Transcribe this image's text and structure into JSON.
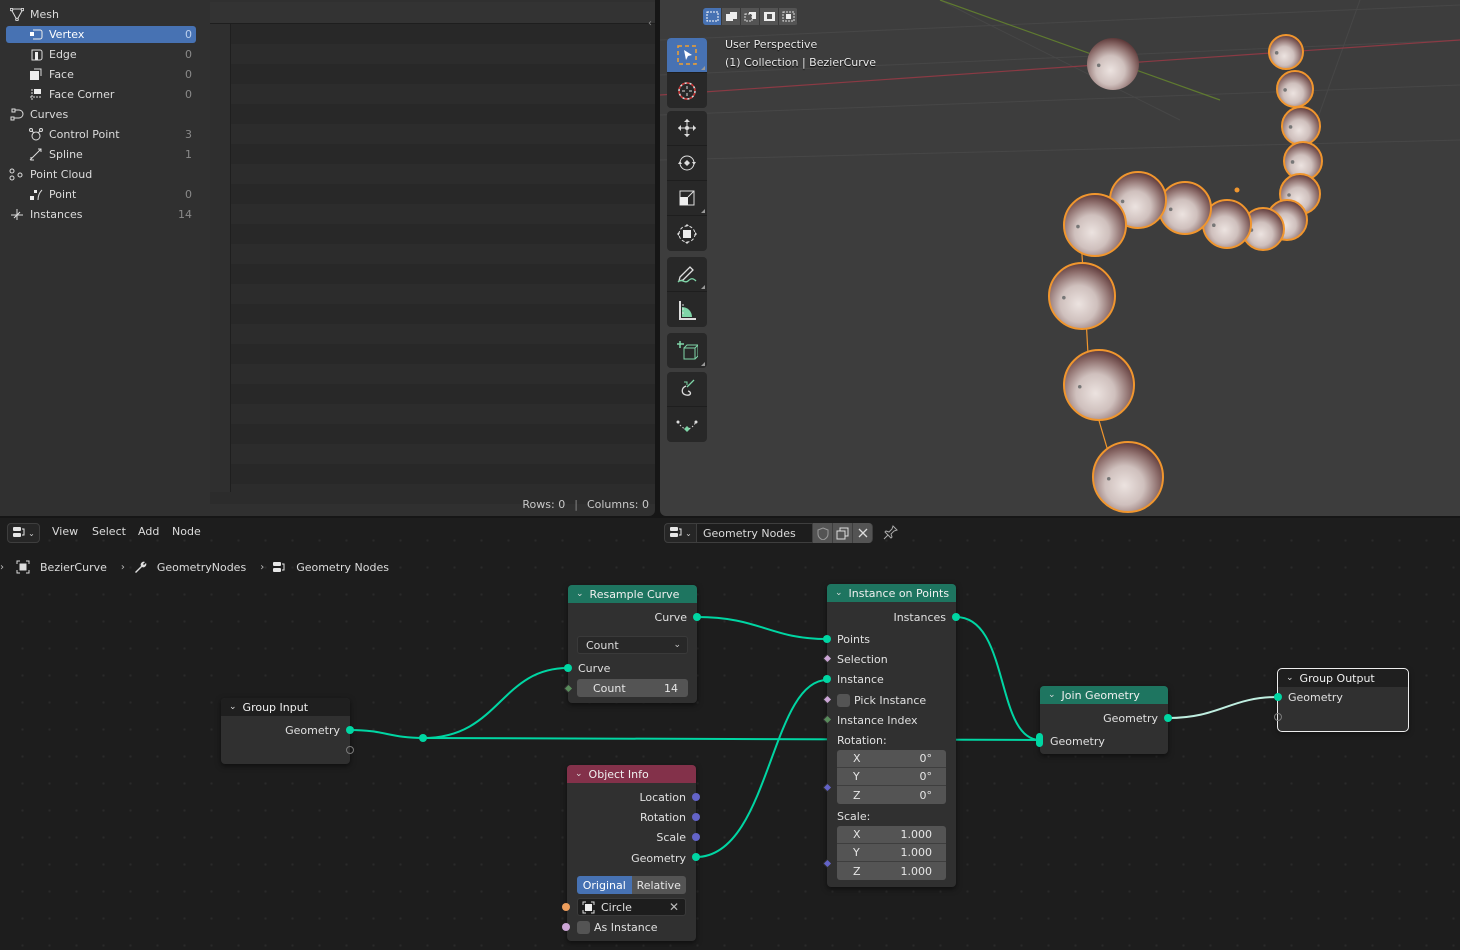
{
  "spreadsheet": {
    "domains": [
      {
        "label": "Mesh",
        "icon": "mesh-icon",
        "level": 0,
        "count": null,
        "selected": false
      },
      {
        "label": "Vertex",
        "icon": "vertex-icon",
        "level": 1,
        "count": "0",
        "selected": true
      },
      {
        "label": "Edge",
        "icon": "edge-icon",
        "level": 1,
        "count": "0",
        "selected": false
      },
      {
        "label": "Face",
        "icon": "face-icon",
        "level": 1,
        "count": "0",
        "selected": false
      },
      {
        "label": "Face Corner",
        "icon": "face-corner-icon",
        "level": 1,
        "count": "0",
        "selected": false
      },
      {
        "label": "Curves",
        "icon": "curves-icon",
        "level": 0,
        "count": null,
        "selected": false
      },
      {
        "label": "Control Point",
        "icon": "control-point-icon",
        "level": 1,
        "count": "3",
        "selected": false
      },
      {
        "label": "Spline",
        "icon": "spline-icon",
        "level": 1,
        "count": "1",
        "selected": false
      },
      {
        "label": "Point Cloud",
        "icon": "point-cloud-icon",
        "level": 0,
        "count": null,
        "selected": false
      },
      {
        "label": "Point",
        "icon": "point-icon",
        "level": 1,
        "count": "0",
        "selected": false
      },
      {
        "label": "Instances",
        "icon": "instances-icon",
        "level": 0,
        "count": "14",
        "selected": false
      }
    ],
    "footer": {
      "rows": "Rows: 0",
      "separator": "|",
      "columns": "Columns: 0"
    }
  },
  "viewport": {
    "perspective": "User Perspective",
    "collection": "(1) Collection | BezierCurve",
    "select_modes": [
      "select-new-icon",
      "select-extend-icon",
      "select-subtract-icon",
      "select-invert-icon",
      "select-intersect-icon"
    ],
    "tools": [
      {
        "group": 0,
        "name": "select-box-tool",
        "active": true
      },
      {
        "group": 0,
        "name": "cursor-tool",
        "active": false
      },
      {
        "group": 1,
        "name": "move-tool",
        "active": false
      },
      {
        "group": 1,
        "name": "rotate-tool",
        "active": false
      },
      {
        "group": 1,
        "name": "scale-tool",
        "active": false
      },
      {
        "group": 1,
        "name": "transform-tool",
        "active": false
      },
      {
        "group": 2,
        "name": "annotate-tool",
        "active": false
      },
      {
        "group": 2,
        "name": "measure-tool",
        "active": false
      },
      {
        "group": 3,
        "name": "add-cube-tool",
        "active": false
      },
      {
        "group": 4,
        "name": "draw-curve-tool",
        "active": false
      },
      {
        "group": 4,
        "name": "pen-tool",
        "active": false
      }
    ],
    "colors": {
      "selection_outline": "#f0962e",
      "x_axis": "#8b3a44",
      "y_axis": "#5f7a30"
    }
  },
  "node_editor": {
    "menu": [
      "View",
      "Select",
      "Add",
      "Node"
    ],
    "tree_name": "Geometry Nodes",
    "breadcrumb": [
      "BezierCurve",
      "GeometryNodes",
      "Geometry Nodes"
    ],
    "nodes": {
      "group_input": {
        "title": "Group Input",
        "outputs": [
          "Geometry"
        ]
      },
      "resample_curve": {
        "title": "Resample Curve",
        "output": "Curve",
        "mode": "Count",
        "input_curve": "Curve",
        "count_label": "Count",
        "count_value": "14"
      },
      "object_info": {
        "title": "Object Info",
        "outputs": [
          "Location",
          "Rotation",
          "Scale",
          "Geometry"
        ],
        "transform_space": [
          "Original",
          "Relative"
        ],
        "transform_space_selected": "Original",
        "object": "Circle",
        "as_instance": "As Instance"
      },
      "instance_on_points": {
        "title": "Instance on Points",
        "output": "Instances",
        "inputs": [
          "Points",
          "Selection",
          "Instance",
          "Pick Instance",
          "Instance Index"
        ],
        "rotation_label": "Rotation:",
        "rotation": [
          {
            "axis": "X",
            "value": "0°"
          },
          {
            "axis": "Y",
            "value": "0°"
          },
          {
            "axis": "Z",
            "value": "0°"
          }
        ],
        "scale_label": "Scale:",
        "scale": [
          {
            "axis": "X",
            "value": "1.000"
          },
          {
            "axis": "Y",
            "value": "1.000"
          },
          {
            "axis": "Z",
            "value": "1.000"
          }
        ]
      },
      "join_geometry": {
        "title": "Join Geometry",
        "output": "Geometry",
        "input": "Geometry"
      },
      "group_output": {
        "title": "Group Output",
        "input": "Geometry"
      }
    },
    "colors": {
      "geometry_socket": "#00d6a3",
      "vector_socket": "#6363c7",
      "geometry_header": "#1e7560",
      "object_header": "#83314a",
      "accent": "#4772b3"
    }
  }
}
